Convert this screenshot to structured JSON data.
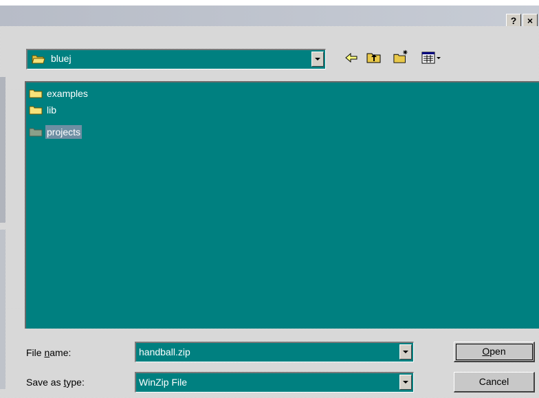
{
  "titlebar": {
    "help_label": "?",
    "close_label": "×"
  },
  "look_in": {
    "value": "bluej"
  },
  "toolbar": {
    "back_icon": "back-arrow-icon",
    "up_icon": "up-one-level-icon",
    "new_folder_icon": "new-folder-icon",
    "view_icon": "view-menu-icon"
  },
  "files": [
    {
      "name": "examples",
      "selected": false
    },
    {
      "name": "lib",
      "selected": false
    },
    {
      "name": "projects",
      "selected": true
    }
  ],
  "file_name": {
    "label_pre": "File ",
    "label_key": "n",
    "label_post": "ame:",
    "value": "handball.zip"
  },
  "save_type": {
    "label_pre": "Save as ",
    "label_key": "t",
    "label_post": "ype:",
    "value": "WinZip File"
  },
  "buttons": {
    "open_key": "O",
    "open_rest": "pen",
    "cancel": "Cancel"
  },
  "colors": {
    "list_bg": "#008080",
    "selection": "#6e8fa3",
    "face": "#d4d0c8"
  }
}
